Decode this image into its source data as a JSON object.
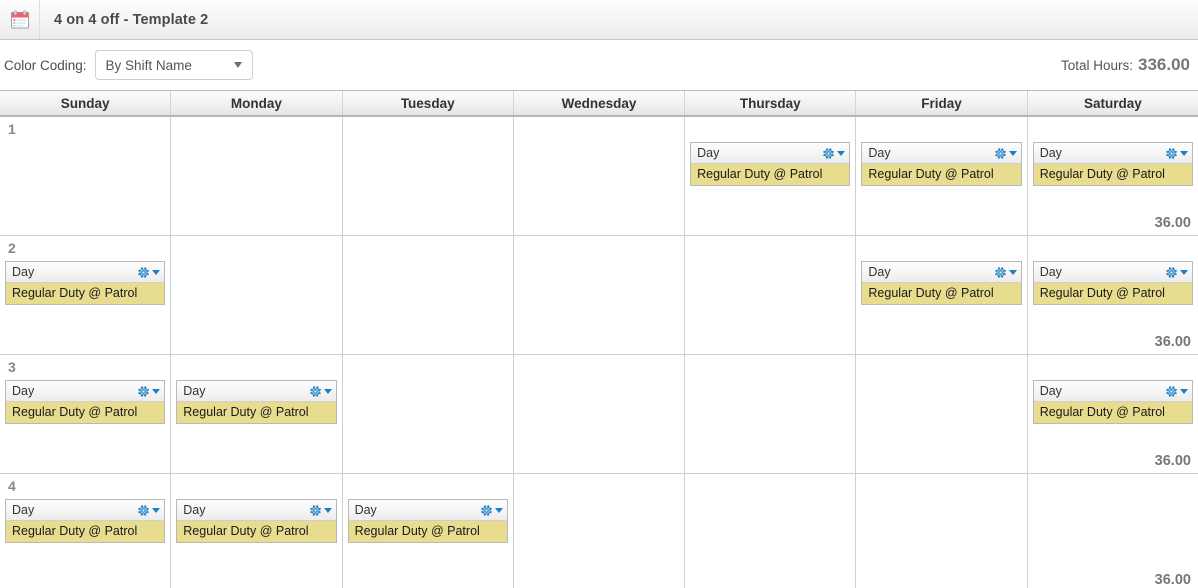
{
  "titlebar": {
    "icon": "calendar-icon",
    "title": "4 on 4 off - Template 2"
  },
  "toolbar": {
    "color_coding_label": "Color Coding:",
    "color_coding_value": "By Shift Name",
    "color_coding_options": [
      "By Shift Name"
    ],
    "total_hours_label": "Total Hours:",
    "total_hours_value": "336.00"
  },
  "calendar": {
    "day_headers": [
      "Sunday",
      "Monday",
      "Tuesday",
      "Wednesday",
      "Thursday",
      "Friday",
      "Saturday"
    ],
    "shift_name": "Day",
    "shift_assignment": "Regular Duty @ Patrol",
    "menu_icon": "gear-icon",
    "rows": [
      {
        "daynum": "1",
        "hours": "36.00",
        "cells": [
          false,
          false,
          false,
          false,
          true,
          true,
          true
        ]
      },
      {
        "daynum": "2",
        "hours": "36.00",
        "cells": [
          true,
          false,
          false,
          false,
          false,
          true,
          true
        ]
      },
      {
        "daynum": "3",
        "hours": "36.00",
        "cells": [
          true,
          true,
          false,
          false,
          false,
          false,
          true
        ]
      },
      {
        "daynum": "4",
        "hours": "36.00",
        "cells": [
          true,
          true,
          true,
          false,
          false,
          false,
          false
        ]
      }
    ]
  },
  "colors": {
    "shift_body": "#e8dc8e",
    "accent": "#1b7fc4",
    "hours_text": "#777777"
  }
}
